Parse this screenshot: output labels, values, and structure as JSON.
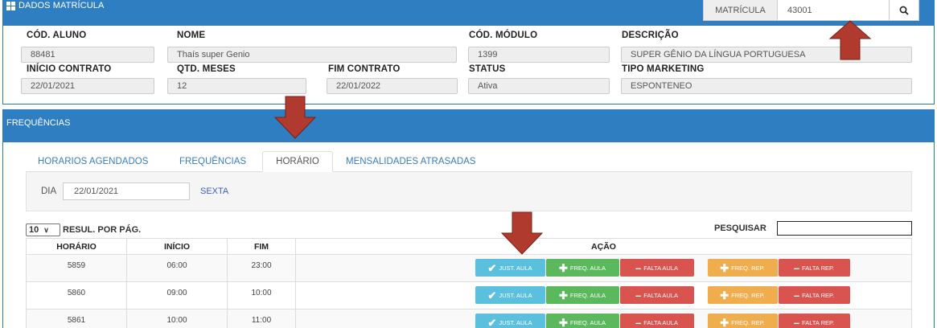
{
  "matricula_panel": {
    "title": "DADOS MATRÍCULA",
    "search_label": "MATRÍCULA",
    "search_value": "43001",
    "fields": {
      "cod_aluno": {
        "label": "CÓD. ALUNO",
        "value": "88481"
      },
      "nome": {
        "label": "NOME",
        "value": "Thaís super Genio"
      },
      "cod_modulo": {
        "label": "CÓD. MÓDULO",
        "value": "1399"
      },
      "descricao": {
        "label": "DESCRIÇÃO",
        "value": "SUPER GÊNIO DA LÍNGUA PORTUGUESA"
      },
      "inicio_contrato": {
        "label": "INÍCIO CONTRATO",
        "value": "22/01/2021"
      },
      "qtd_meses": {
        "label": "QTD. MESES",
        "value": "12"
      },
      "fim_contrato": {
        "label": "FIM CONTRATO",
        "value": "22/01/2022"
      },
      "status": {
        "label": "STATUS",
        "value": "Ativa"
      },
      "tipo_marketing": {
        "label": "TIPO MARKETING",
        "value": "ESPONTENEO"
      }
    }
  },
  "frequencias_panel": {
    "title": "FREQUÊNCIAS",
    "tabs": [
      "HORARIOS AGENDADOS",
      "FREQUÊNCIAS",
      "HORÁRIO",
      "MENSALIDADES ATRASADAS"
    ],
    "active_tab": "HORÁRIO",
    "dia_label": "DIA",
    "dia_value": "22/01/2021",
    "dia_weekday": "SEXTA",
    "per_page_value": "10",
    "per_page_label": "RESUL. POR PÁG.",
    "search_label": "PESQUISAR",
    "table": {
      "headers": [
        "HORÁRIO",
        "INÍCIO",
        "FIM",
        "AÇÃO"
      ],
      "rows": [
        {
          "horario": "5859",
          "inicio": "06:00",
          "fim": "23:00"
        },
        {
          "horario": "5860",
          "inicio": "09:00",
          "fim": "10:00"
        },
        {
          "horario": "5861",
          "inicio": "10:00",
          "fim": "11:00"
        }
      ],
      "actions": {
        "just_aula": "JUST. AULA",
        "freq_aula": "FREQ. AULA",
        "falta_aula": "FALTA AULA",
        "freq_rep": "FREQ. REP.",
        "falta_rep": "FALTA REP."
      }
    }
  },
  "colors": {
    "header_blue": "#2f7ec2",
    "arrow_red": "#b03a2e",
    "btn_info": "#5bc0de",
    "btn_success": "#5cb85c",
    "btn_danger": "#d9534f",
    "btn_warning": "#f0ad4e"
  },
  "icons": [
    "grid-icon",
    "search-icon",
    "check-icon",
    "plus-icon",
    "minus-icon",
    "chevron-down-icon",
    "arrow-annotation"
  ]
}
